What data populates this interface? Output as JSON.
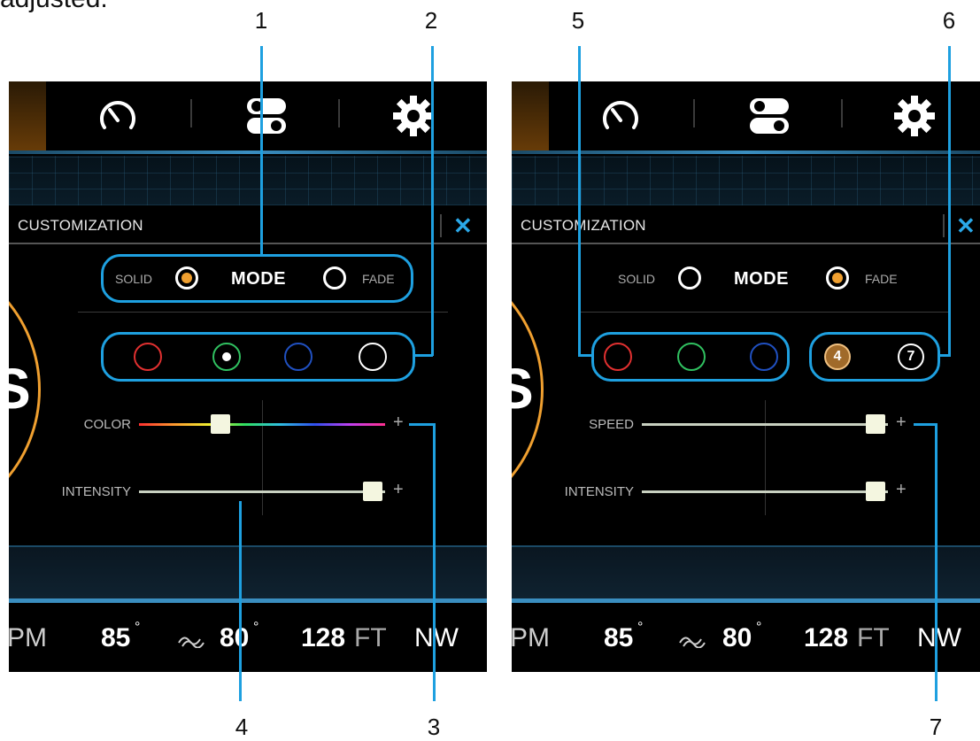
{
  "caption": {
    "top_text": "adjusted."
  },
  "callouts": [
    "1",
    "2",
    "3",
    "4",
    "5",
    "6",
    "7"
  ],
  "colors": {
    "accent_orange": "#f0a030",
    "callout_blue": "#1ea0e0",
    "close_blue": "#2aa8e8"
  },
  "icons": {
    "header": [
      "speedometer-icon",
      "toggles-icon",
      "gear-icon"
    ],
    "status_wave": "wave-icon"
  },
  "left_screen": {
    "panel_title": "CUSTOMIZATION",
    "close_glyph": "✕",
    "mode": {
      "solid_label": "SOLID",
      "title": "MODE",
      "fade_label": "FADE",
      "selected": "solid"
    },
    "colors": [
      "#e03030",
      "#30c060",
      "#2050c0",
      "#ffffff"
    ],
    "selected_color_index": 1,
    "sliders": [
      {
        "label": "COLOR",
        "value_fraction": 0.33,
        "plus": "+"
      },
      {
        "label": "INTENSITY",
        "value_fraction": 0.95,
        "plus": "+"
      }
    ],
    "status": {
      "left_partial": "PM",
      "temp1": "85",
      "temp2": "80",
      "depth": "128",
      "depth_unit": "FT",
      "heading": "NW",
      "degree": "°"
    }
  },
  "right_screen": {
    "panel_title": "CUSTOMIZATION",
    "close_glyph": "✕",
    "mode": {
      "solid_label": "SOLID",
      "title": "MODE",
      "fade_label": "FADE",
      "selected": "fade"
    },
    "colors": [
      "#e03030",
      "#30c060",
      "#2050c0"
    ],
    "speeds": [
      "4",
      "7"
    ],
    "selected_speed_index": 0,
    "sliders": [
      {
        "label": "SPEED",
        "value_fraction": 0.95,
        "plus": "+"
      },
      {
        "label": "INTENSITY",
        "value_fraction": 0.95,
        "plus": "+"
      }
    ],
    "status": {
      "left_partial": "PM",
      "temp1": "85",
      "temp2": "80",
      "depth": "128",
      "depth_unit": "FT",
      "heading": "NW",
      "degree": "°"
    }
  }
}
